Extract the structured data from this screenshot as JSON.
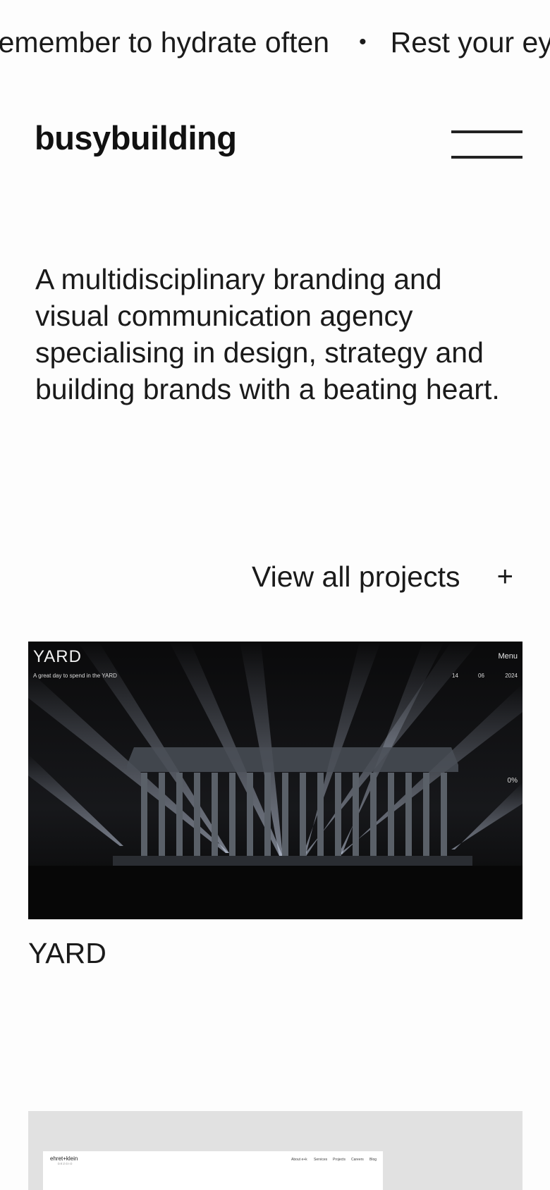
{
  "marquee": {
    "items": [
      "Remember to hydrate often",
      "Rest your eyes and stretch"
    ],
    "separator": "•"
  },
  "header": {
    "logo": "busybuilding",
    "menu_icon": "hamburger-menu-icon"
  },
  "intro": {
    "text": "A multidisciplinary branding and visual communication agency specialising in design, strategy and building brands with a beating heart."
  },
  "view_all": {
    "label": "View all projects",
    "icon": "+"
  },
  "projects": [
    {
      "title": "YARD",
      "preview": {
        "logo": "YARD",
        "tagline": "A great day to spend in the YARD",
        "menu": "Menu",
        "date_day": "14",
        "date_month": "06",
        "date_year": "2024",
        "progress": "0%"
      }
    },
    {
      "preview": {
        "logo": "ehret+klein",
        "logo_sub": "DEZGIO",
        "nav": [
          "About e+k",
          "Services",
          "Projects",
          "Careers",
          "Blog"
        ]
      }
    }
  ],
  "colors": {
    "background": "#fdfdfd",
    "text": "#1a1a1a",
    "project_dark": "#0b0b0c",
    "project_light": "#e1e1e1"
  }
}
